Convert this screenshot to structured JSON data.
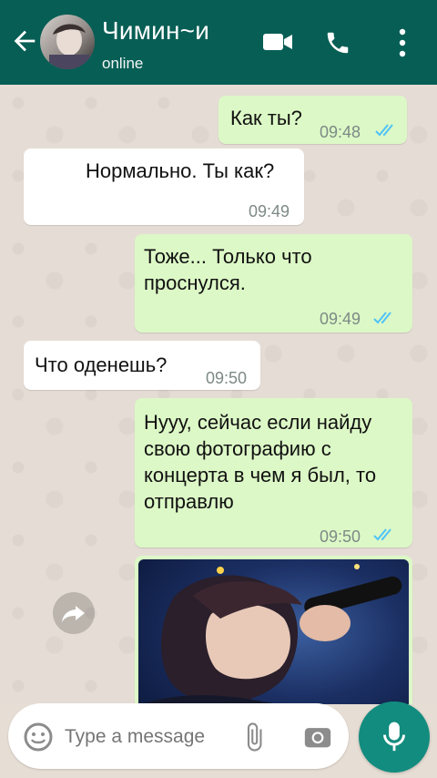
{
  "header": {
    "contact_name": "Чимин~и",
    "status": "online",
    "color": "#075e54"
  },
  "messages": [
    {
      "direction": "out",
      "text": "Как ты?",
      "time": "09:48",
      "read": true
    },
    {
      "direction": "in",
      "text": "Нормально. Ты как?",
      "time": "09:49"
    },
    {
      "direction": "out",
      "text": "Тоже... Только что проснулся.",
      "time": "09:49",
      "read": true
    },
    {
      "direction": "in",
      "text": "Что оденешь?",
      "time": "09:50"
    },
    {
      "direction": "out",
      "text": "Нууу, сейчас если найду свою фотографию с концерта в чем я был, то отправлю",
      "time": "09:50",
      "read": true
    },
    {
      "direction": "out",
      "type": "image"
    }
  ],
  "composer": {
    "placeholder": "Type a message"
  },
  "icons": {
    "back": "arrow-left-icon",
    "video": "video-camera-icon",
    "call": "phone-icon",
    "menu": "more-vert-icon",
    "emoji": "emoji-icon",
    "attach": "paperclip-icon",
    "camera": "camera-icon",
    "mic": "microphone-icon",
    "forward": "forward-icon"
  },
  "colors": {
    "outgoing_bubble": "#dcf8c6",
    "incoming_bubble": "#ffffff",
    "read_ticks": "#4fc3f7",
    "fab": "#128c7e"
  }
}
